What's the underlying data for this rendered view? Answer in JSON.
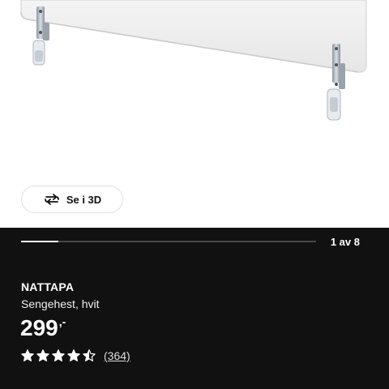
{
  "gallery": {
    "view_3d_label": "Se i 3D",
    "view_3d_icon": "rotate-3d-icon",
    "page_counter": "1 av 8",
    "current_page": 1,
    "total_pages": 8
  },
  "product": {
    "name": "NATTAPA",
    "description": "Sengehest, hvit",
    "price": "299",
    "price_suffix": ",-",
    "rating": 4.5,
    "rating_max": 5,
    "review_count_label": "(364)"
  },
  "colors": {
    "panel_background": "#111111",
    "accent": "#ffffff"
  }
}
